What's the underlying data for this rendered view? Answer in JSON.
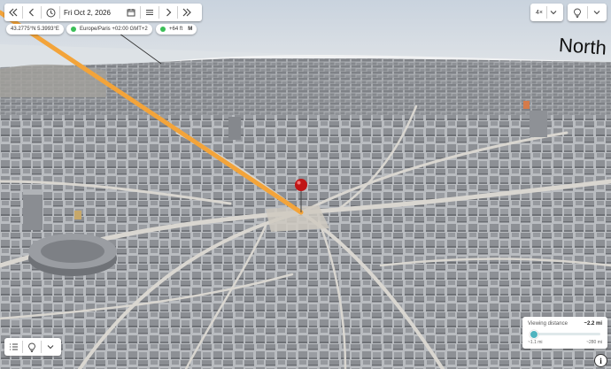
{
  "toolbar": {
    "date": "Fri Oct 2, 2026",
    "icons": [
      "double-chevron-left-icon",
      "chevron-left-icon",
      "clock-icon",
      "calendar-icon",
      "menu-icon",
      "chevron-right-icon",
      "double-chevron-right-icon"
    ]
  },
  "status": {
    "coordinates": "43.2775°N 5.3993°E",
    "timezone": "Europe/Paris +02:00 GMT+2",
    "timezone_color": "#3cbf58",
    "elevation": "+64 ft",
    "elevation_badge": "M",
    "elevation_color": "#3cbf58"
  },
  "top_right": {
    "speed": "4×",
    "icons": [
      "chevron-down-icon",
      "lightbulb-icon",
      "chevron-down-icon"
    ]
  },
  "map": {
    "direction_label": "North",
    "sun_ray_color": "#f3a43a",
    "pin_color": "#c01616"
  },
  "viewing_distance": {
    "title": "Viewing distance",
    "value": "~2.2 mi",
    "min": "~1.1 mi",
    "max": "~280 mi",
    "level": 0.05
  },
  "bottom_left": {
    "icons": [
      "layers-list-icon",
      "lightbulb-icon",
      "chevron-down-icon"
    ]
  },
  "info_button": "i"
}
